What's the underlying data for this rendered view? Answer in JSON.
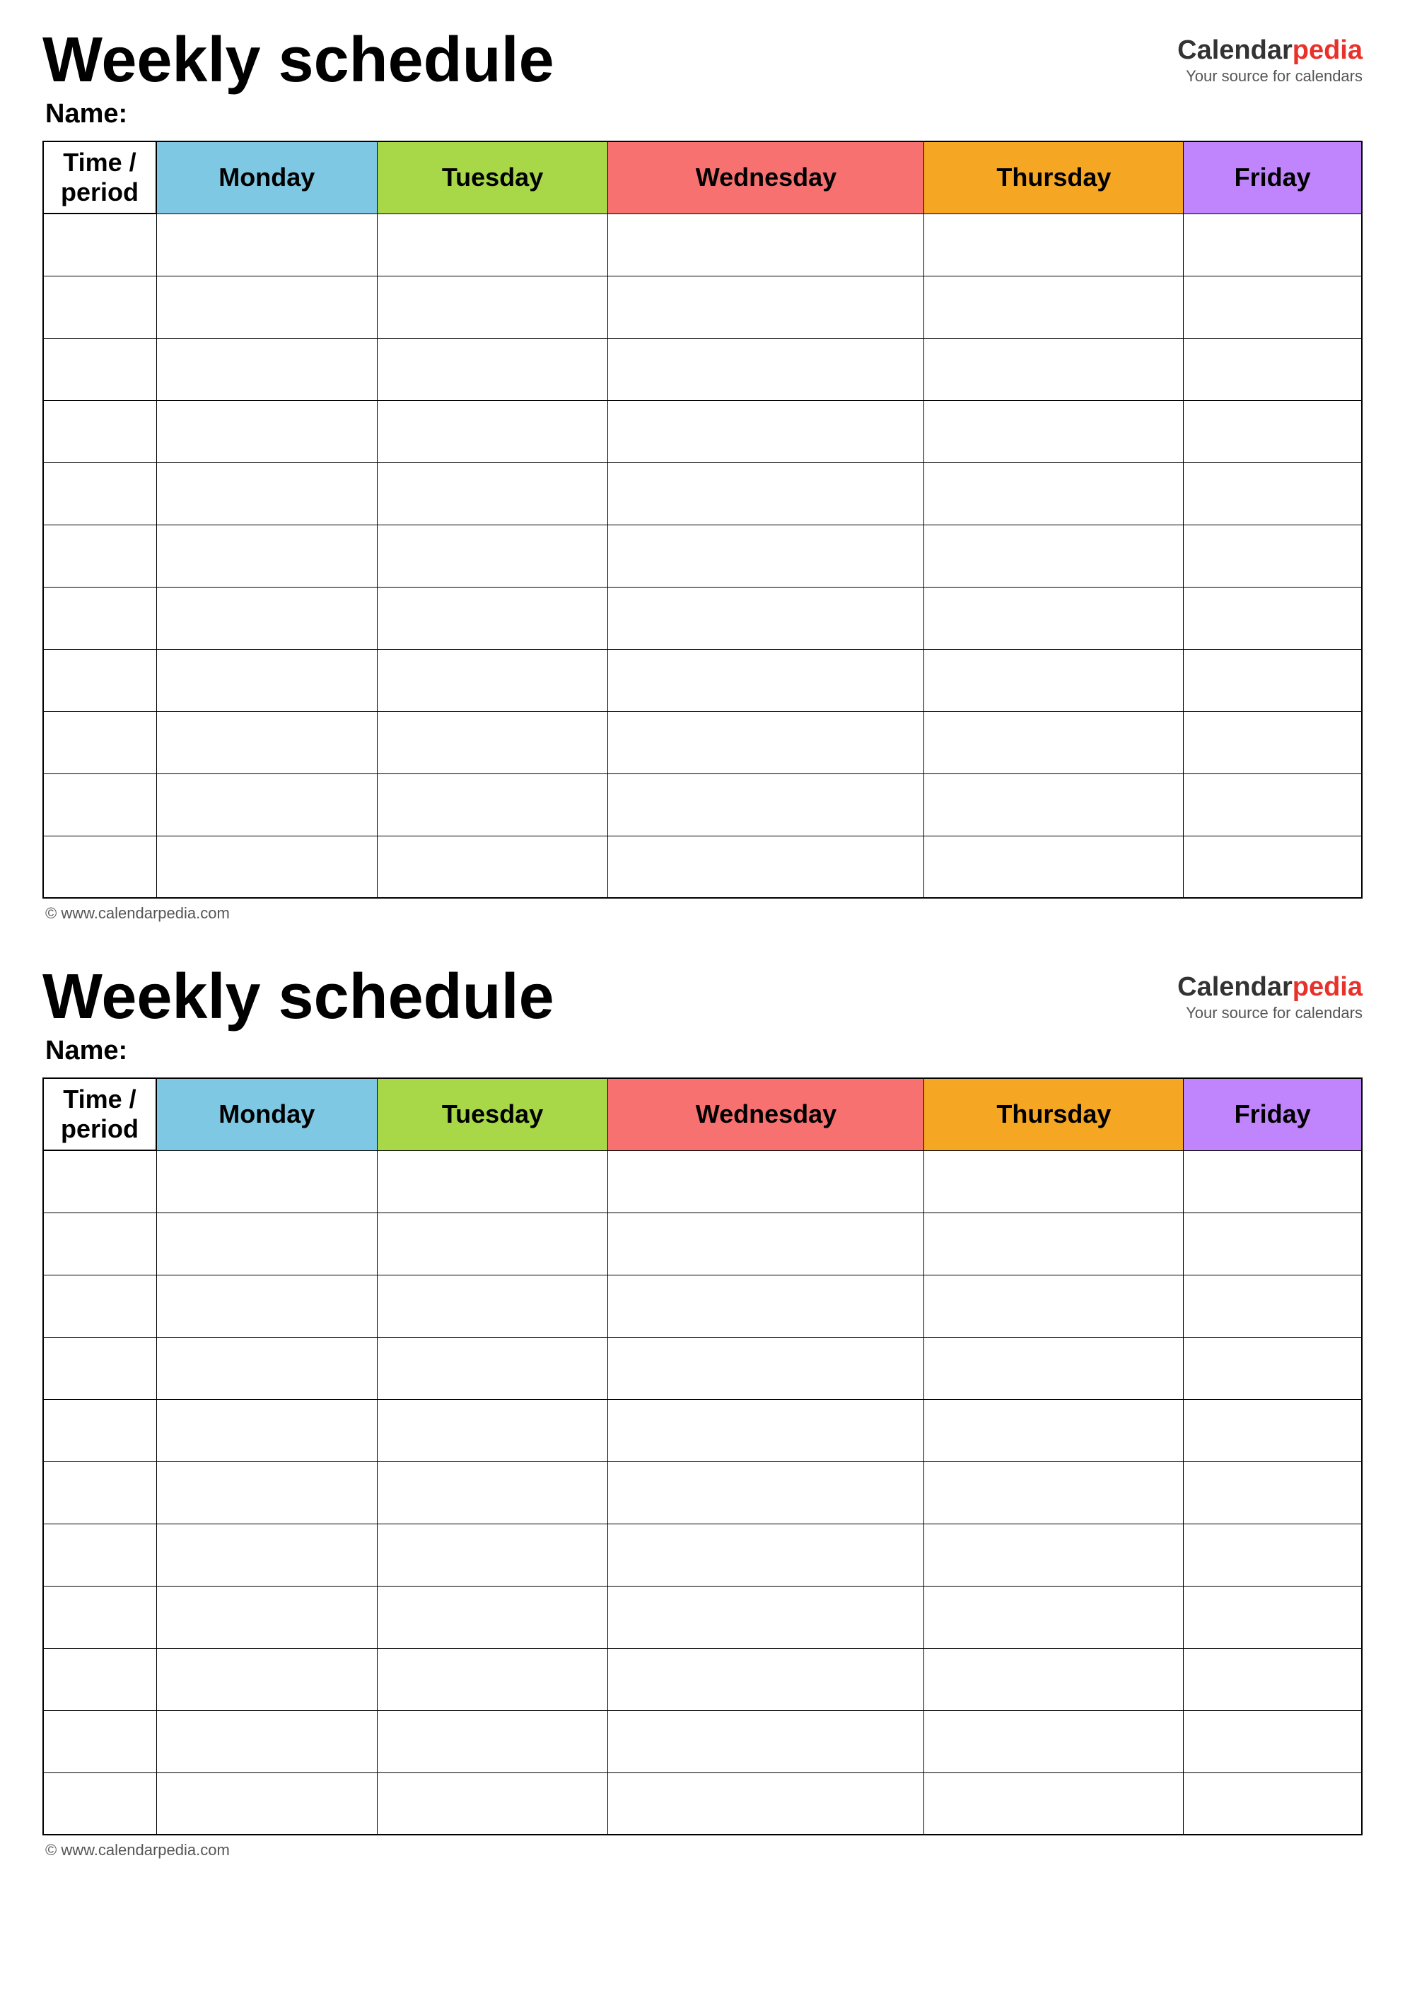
{
  "schedule1": {
    "title": "Weekly schedule",
    "name_label": "Name:",
    "logo": {
      "calendar": "Calendar",
      "pedia": "pedia",
      "sub": "Your source for calendars"
    },
    "table": {
      "headers": [
        {
          "id": "time",
          "label": "Time / period",
          "color": ""
        },
        {
          "id": "monday",
          "label": "Monday",
          "color": "#7ec8e3"
        },
        {
          "id": "tuesday",
          "label": "Tuesday",
          "color": "#a8d848"
        },
        {
          "id": "wednesday",
          "label": "Wednesday",
          "color": "#f87171"
        },
        {
          "id": "thursday",
          "label": "Thursday",
          "color": "#f5a623"
        },
        {
          "id": "friday",
          "label": "Friday",
          "color": "#c084fc"
        }
      ],
      "row_count": 11
    },
    "footer": "© www.calendarpedia.com"
  },
  "schedule2": {
    "title": "Weekly schedule",
    "name_label": "Name:",
    "logo": {
      "calendar": "Calendar",
      "pedia": "pedia",
      "sub": "Your source for calendars"
    },
    "table": {
      "headers": [
        {
          "id": "time",
          "label": "Time / period",
          "color": ""
        },
        {
          "id": "monday",
          "label": "Monday",
          "color": "#7ec8e3"
        },
        {
          "id": "tuesday",
          "label": "Tuesday",
          "color": "#a8d848"
        },
        {
          "id": "wednesday",
          "label": "Wednesday",
          "color": "#f87171"
        },
        {
          "id": "thursday",
          "label": "Thursday",
          "color": "#f5a623"
        },
        {
          "id": "friday",
          "label": "Friday",
          "color": "#c084fc"
        }
      ],
      "row_count": 11
    },
    "footer": "© www.calendarpedia.com"
  }
}
